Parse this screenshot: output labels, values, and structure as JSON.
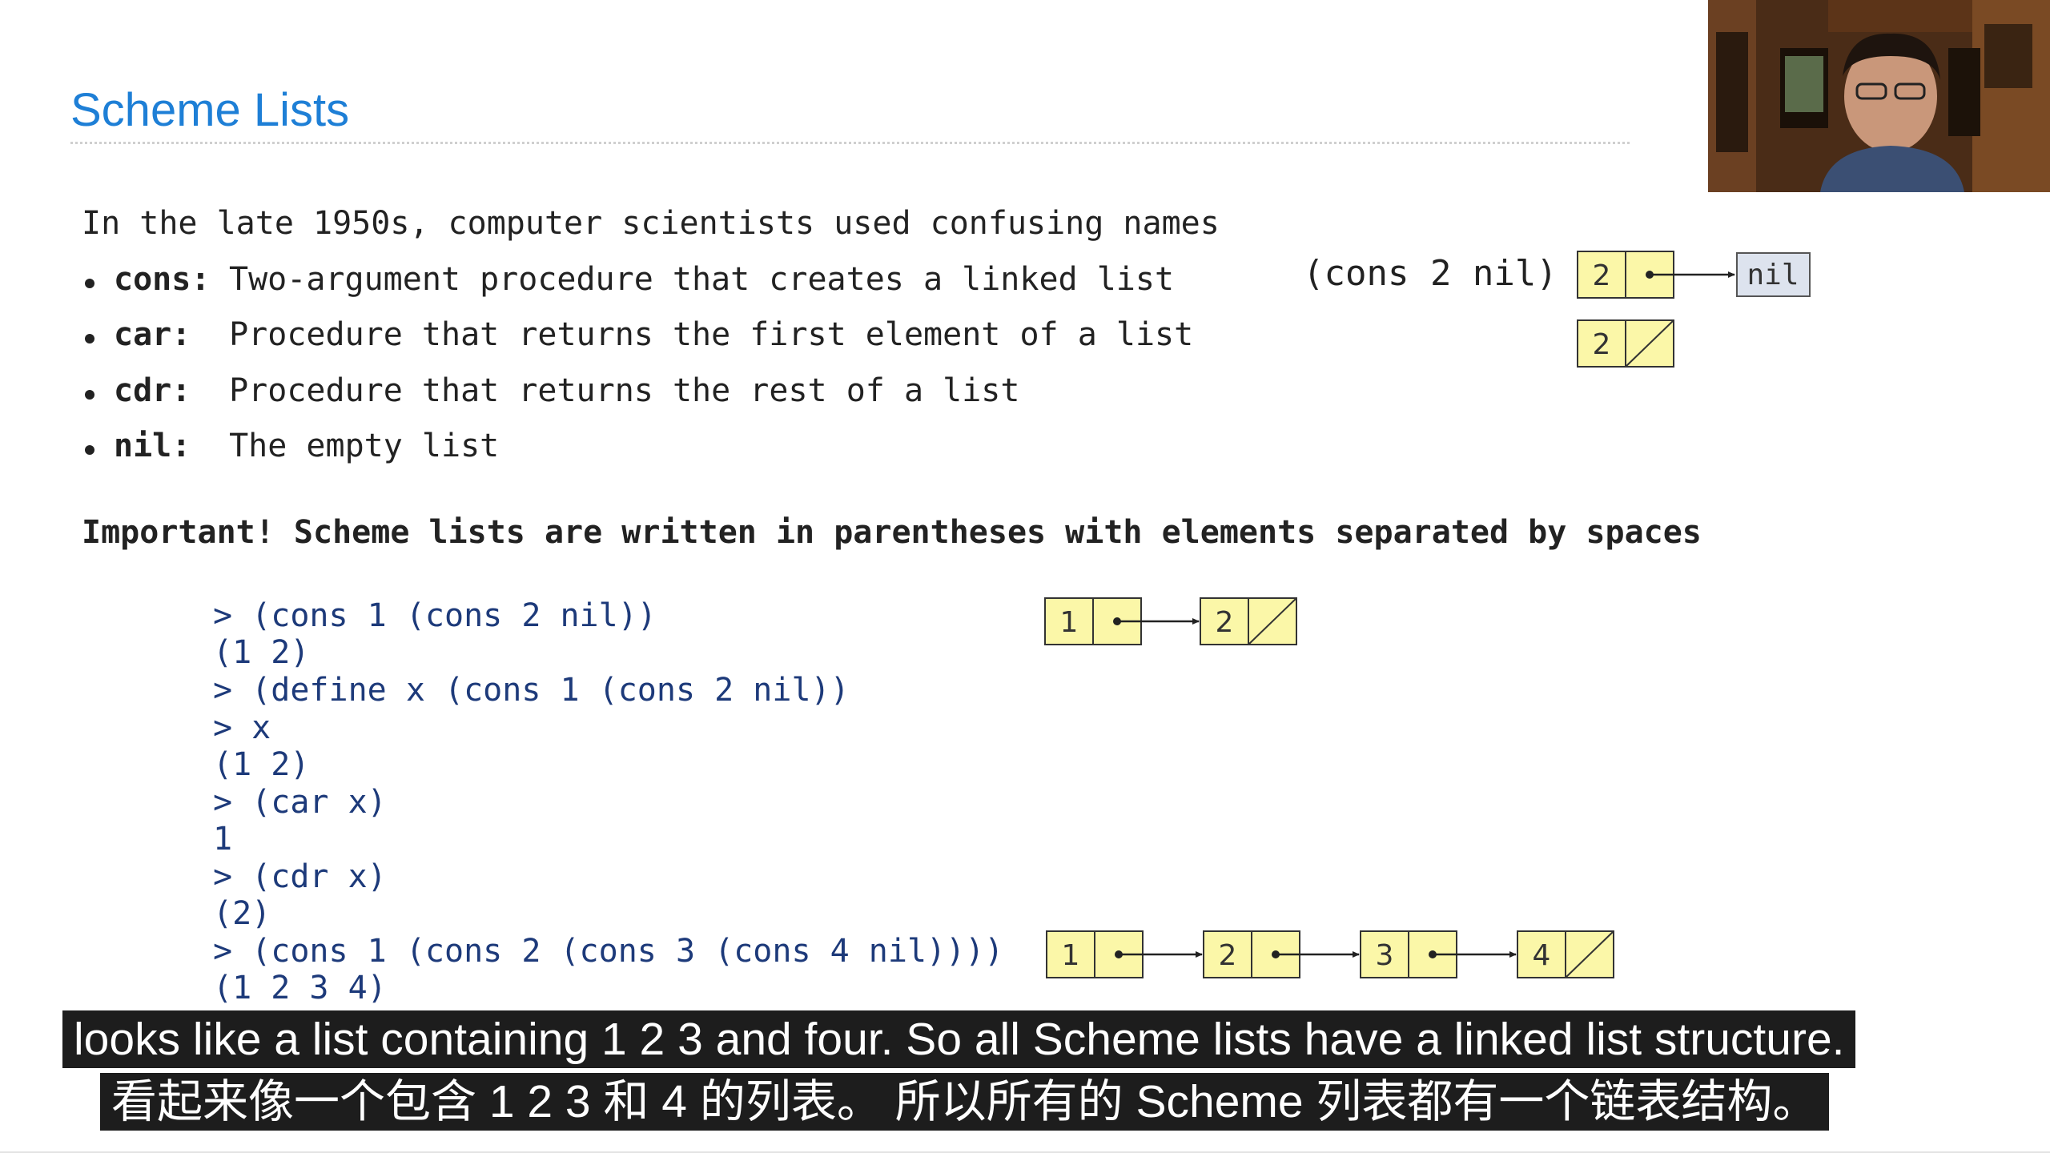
{
  "slide": {
    "title": "Scheme Lists",
    "intro": "In the late 1950s, computer scientists used confusing names",
    "bullets": [
      {
        "term": "cons:",
        "desc": "Two-argument procedure that creates a linked list"
      },
      {
        "term": "car:",
        "desc": " Procedure that returns the first element of a list"
      },
      {
        "term": "cdr:",
        "desc": " Procedure that returns the rest of a list"
      },
      {
        "term": "nil:",
        "desc": " The empty list"
      }
    ],
    "important": "Important! Scheme lists are written in parentheses with elements separated by spaces",
    "cons_expr": "(cons 2 nil)",
    "code_lines": [
      "> (cons 1 (cons 2 nil))",
      "(1 2)",
      "> (define x (cons 1 (cons 2 nil))",
      "> x",
      "(1 2)",
      "> (car x)",
      "1",
      "> (cdr x)",
      "(2)",
      "> (cons 1 (cons 2 (cons 3 (cons 4 nil))))",
      "(1 2 3 4)"
    ]
  },
  "diagrams": {
    "box_color": "#fbf7a8",
    "nil_box_color": "#dde3ee",
    "nil_label": "nil",
    "pair_2_nil": [
      "2"
    ],
    "pair_2_empty": [
      "2"
    ],
    "list_1_2": [
      "1",
      "2"
    ],
    "list_1_2_3_4": [
      "1",
      "2",
      "3",
      "4"
    ]
  },
  "subtitles": {
    "english": "looks like a list containing 1 2 3 and four. So all Scheme lists have a linked list structure.",
    "chinese": "看起来像一个包含 1 2 3 和 4 的列表。 所以所有的 Scheme 列表都有一个链表结构。"
  },
  "colors": {
    "title": "#1e7fd6",
    "code": "#1d3a7a",
    "subtitle_bg": "#1d1d1d"
  },
  "icons": {
    "webcam": "presenter-webcam"
  }
}
